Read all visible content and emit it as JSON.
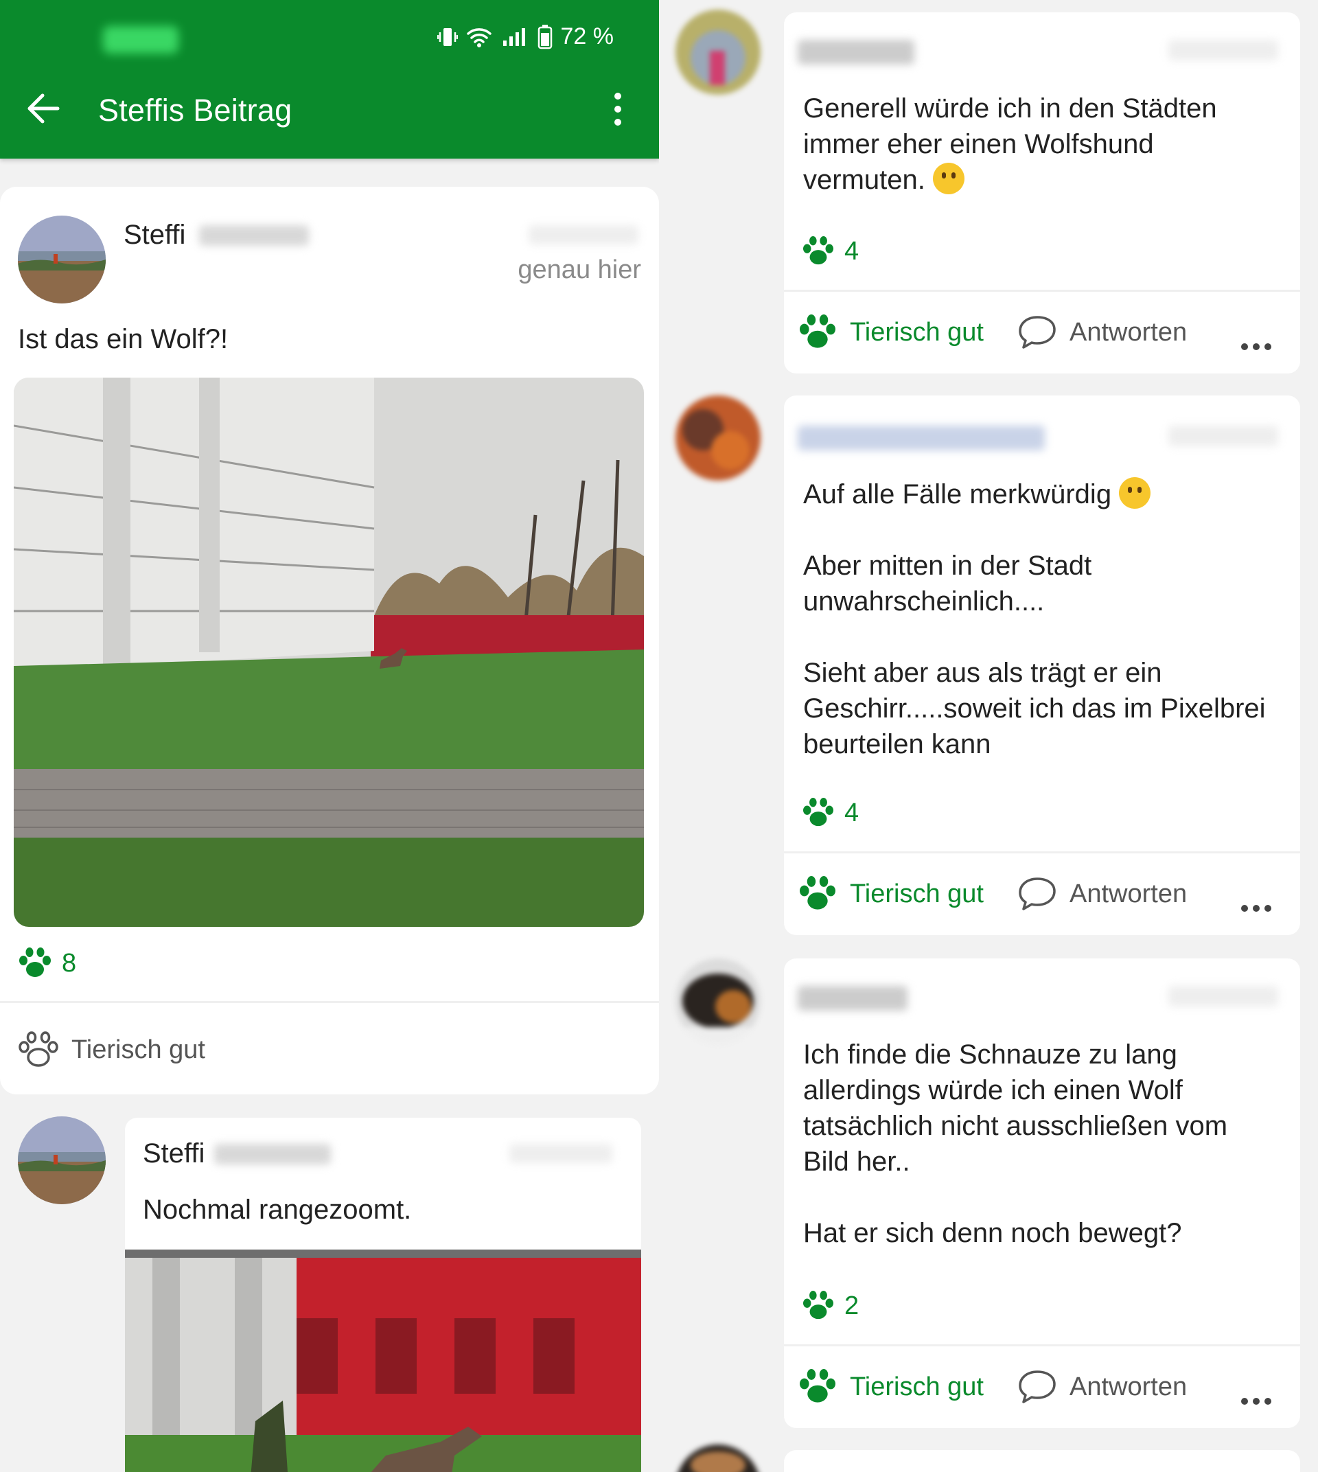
{
  "status_bar": {
    "battery": "72 %"
  },
  "app_bar": {
    "title": "Steffis Beitrag"
  },
  "post": {
    "author": "Steffi",
    "location": "genau hier",
    "text": "Ist das ein Wolf?!",
    "like_count": "8",
    "like_label": "Tierisch gut"
  },
  "reply": {
    "author": "Steffi",
    "text": "Nochmal rangezoomt."
  },
  "comments": [
    {
      "text": "Generell würde ich in den Städten\nimmer eher einen Wolfshund\nvermuten.",
      "emoji": "thinking-face",
      "like_count": "4",
      "like_label": "Tierisch gut",
      "reply_label": "Antworten"
    },
    {
      "text": "Auf alle Fälle merkwürdig",
      "emoji": "raised-eyebrow-face",
      "text2": "Aber mitten in der Stadt\nunwahrscheinlich....",
      "text3": "Sieht aber aus als trägt er ein\nGeschirr.....soweit ich das im Pixelbrei\nbeurteilen kann",
      "like_count": "4",
      "like_label": "Tierisch gut",
      "reply_label": "Antworten"
    },
    {
      "text": "Ich finde die Schnauze zu lang\nallerdings würde ich einen Wolf\ntatsächlich nicht ausschließen vom\nBild her..",
      "text2": "Hat er sich denn noch bewegt?",
      "like_count": "2",
      "like_label": "Tierisch gut",
      "reply_label": "Antworten"
    }
  ],
  "colors": {
    "brand_green": "#0a8a2c",
    "background": "#f2f2f2"
  }
}
